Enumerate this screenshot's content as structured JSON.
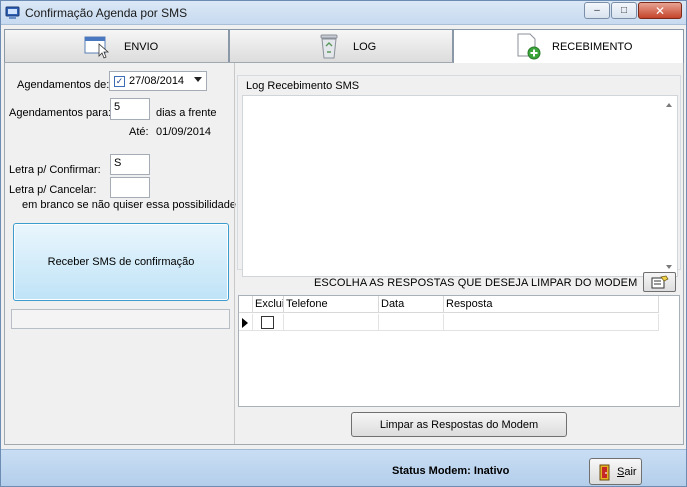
{
  "window": {
    "title": "Confirmação Agenda por SMS",
    "minimize": "‒",
    "maximize": "□",
    "close": "✕"
  },
  "tabs": [
    {
      "label": "ENVIO",
      "icon": "window-cursor-icon",
      "active": false
    },
    {
      "label": "LOG",
      "icon": "recycle-bin-icon",
      "active": false
    },
    {
      "label": "RECEBIMENTO",
      "icon": "document-add-icon",
      "active": true
    }
  ],
  "left": {
    "agendamentos_de_label": "Agendamentos de:",
    "date_checked": true,
    "date_value": "27/08/2014",
    "agendamentos_para_label": "Agendamentos para:",
    "days_value": "5",
    "days_suffix": "dias a frente",
    "ate_label": "Até:",
    "ate_value": "01/09/2014",
    "confirm_label": "Letra p/ Confirmar:",
    "confirm_value": "S",
    "cancel_label": "Letra p/ Cancelar:",
    "cancel_value": "",
    "cancel_hint": "em branco se não quiser essa possibilidade",
    "receive_button": "Receber SMS de confirmação"
  },
  "right": {
    "log_group_title": "Log Recebimento SMS",
    "log_text": "",
    "choose_label": "ESCOLHA AS RESPOSTAS QUE DESEJA LIMPAR DO MODEM",
    "grid_columns": [
      "Exclui",
      "Telefone",
      "Data",
      "Resposta"
    ],
    "clear_button": "Limpar as Respostas do Modem"
  },
  "status": {
    "text": "Status Modem: Inativo",
    "exit_first": "S",
    "exit_rest": "air"
  }
}
